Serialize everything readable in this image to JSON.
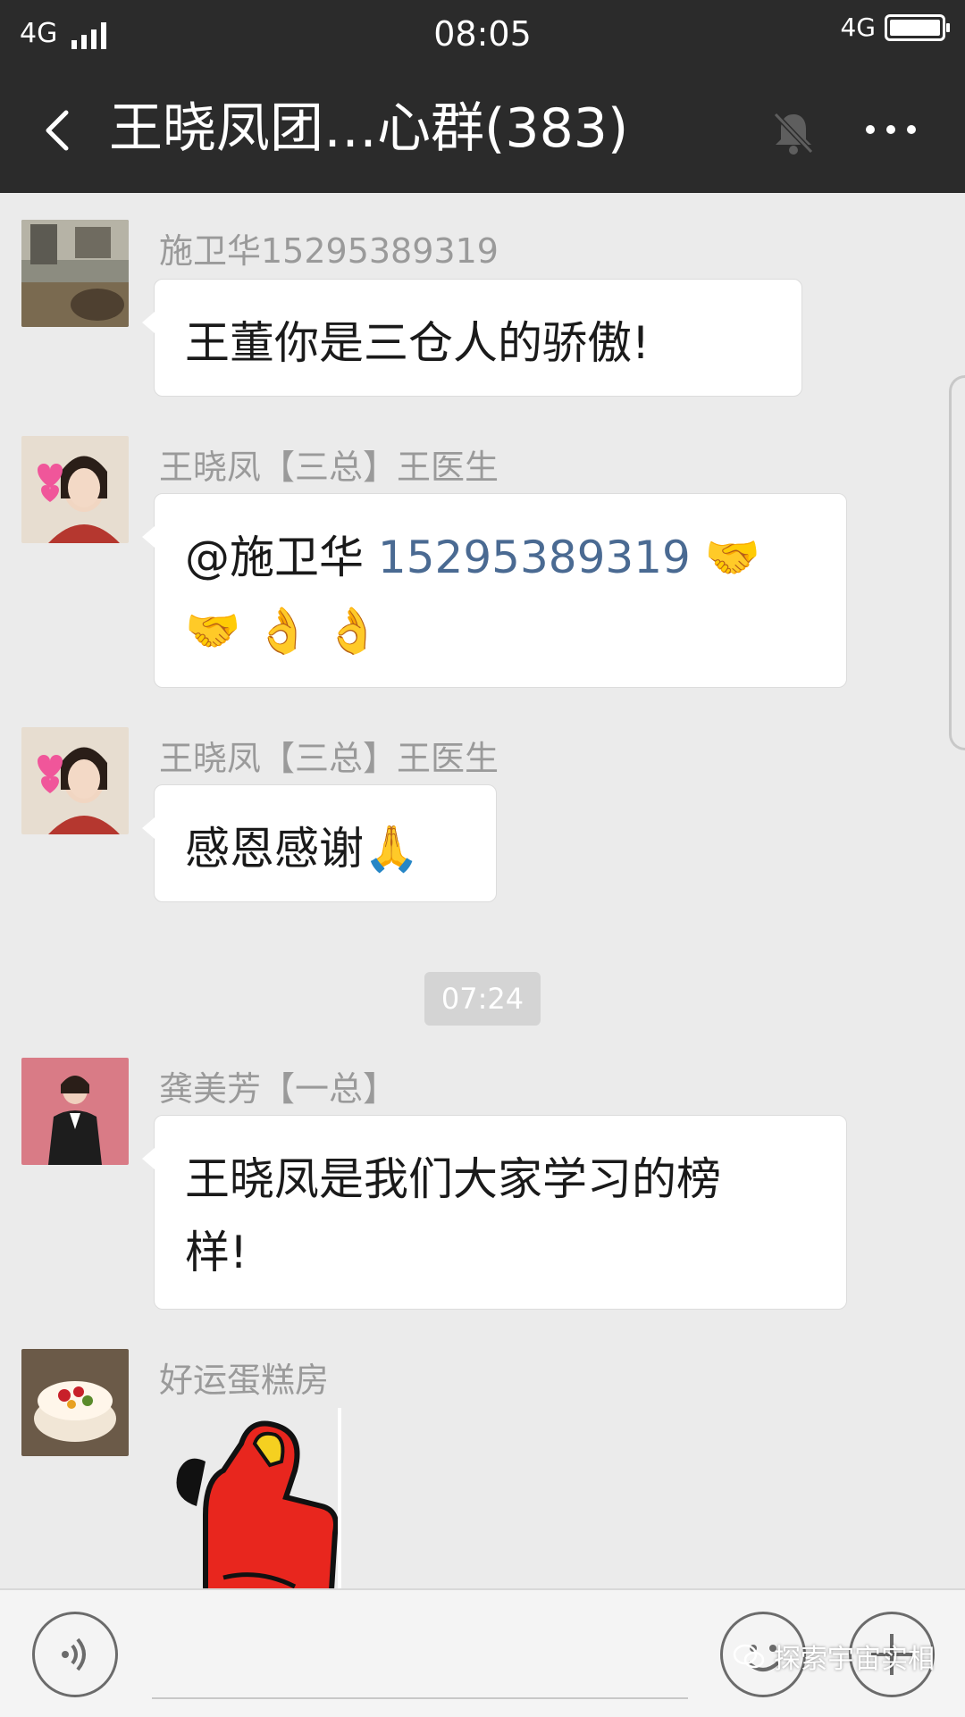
{
  "status_bar": {
    "network_left": "4G",
    "time": "08:05",
    "network_right": "4G"
  },
  "header": {
    "title": "王晓凤团…心群(383)",
    "icons": [
      "back-icon",
      "mute-bell-icon",
      "more-icon"
    ]
  },
  "messages": [
    {
      "sender": "施卫华15295389319",
      "text": "王董你是三仓人的骄傲!"
    },
    {
      "sender": "王晓凤【三总】王医生",
      "mention": "@施卫华",
      "link": "15295389319",
      "emoji": [
        "🤝",
        "🤝",
        "👌",
        "👌"
      ]
    },
    {
      "sender": "王晓凤【三总】王医生",
      "text": "感恩感谢",
      "emoji": "🙏"
    },
    {
      "time": "07:24"
    },
    {
      "sender": "龚美芳【一总】",
      "text_line1": "王晓凤是我们大家学习的榜",
      "text_line2": "样!"
    },
    {
      "sender": "好运蛋糕房",
      "sticker": "thumbs-up-sticker"
    }
  ],
  "input_bar": {
    "icons": [
      "voice-icon",
      "emoji-icon",
      "plus-icon"
    ]
  },
  "watermark": "探索宇宙实相"
}
